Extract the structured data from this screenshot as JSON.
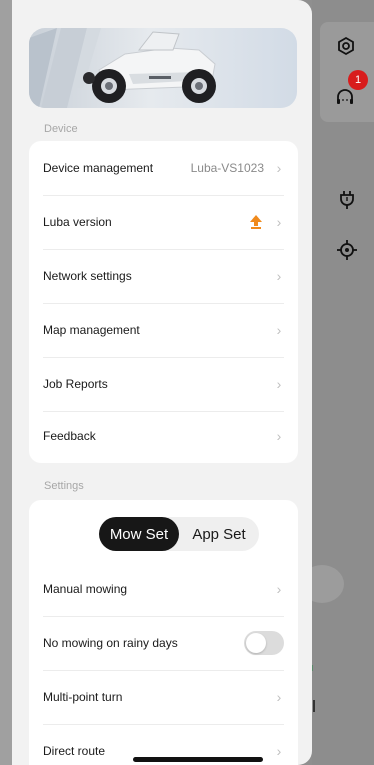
{
  "device_section": {
    "label": "Device"
  },
  "device_items": [
    {
      "label": "Device management",
      "value": "Luba-VS1023"
    },
    {
      "label": "Luba version",
      "value": ""
    },
    {
      "label": "Network settings",
      "value": ""
    },
    {
      "label": "Map management",
      "value": ""
    },
    {
      "label": "Job Reports",
      "value": ""
    },
    {
      "label": "Feedback",
      "value": ""
    }
  ],
  "settings_section": {
    "label": "Settings",
    "tabs": [
      {
        "label": "Mow Set",
        "active": true
      },
      {
        "label": "App Set",
        "active": false
      }
    ],
    "items": [
      {
        "label": "Manual mowing",
        "control": "chevron"
      },
      {
        "label": "No mowing on rainy days",
        "control": "toggle",
        "on": false
      },
      {
        "label": "Multi-point turn",
        "control": "chevron"
      },
      {
        "label": "Direct route",
        "control": "chevron"
      }
    ]
  },
  "side_panel": {
    "icons": [
      "settings-hexagon-icon",
      "support-headset-icon",
      "charging-plug-icon",
      "locate-crosshair-icon"
    ],
    "notification_badge": "1"
  },
  "colors": {
    "drawer_bg": "#f2f2f2",
    "card_bg": "#ffffff",
    "segment_active": "#171717",
    "update_arrow": "#f08a1c",
    "badge": "#d81c1c"
  }
}
